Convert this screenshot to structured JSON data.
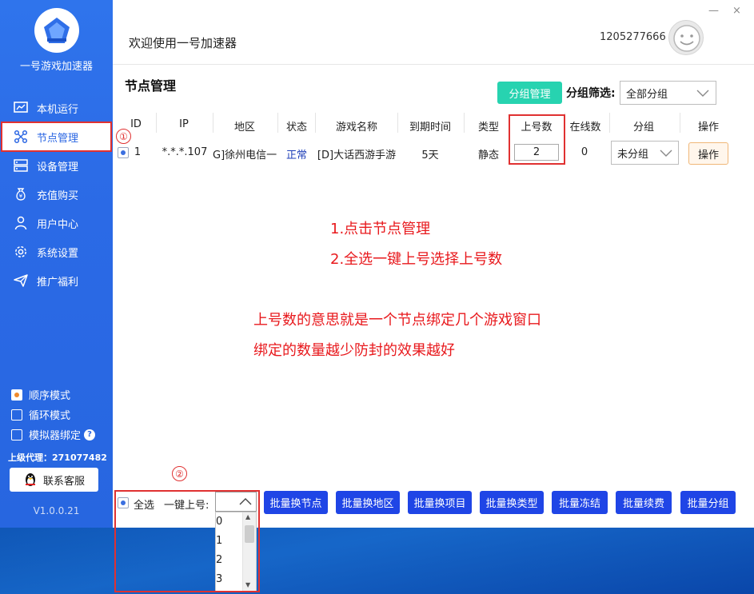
{
  "app": {
    "name": "一号游戏加速器",
    "welcome": "欢迎使用一号加速器",
    "user_id": "1205277666",
    "version": "V1.0.0.21",
    "close_glyph": "×",
    "minimize_glyph": "—"
  },
  "sidebar": {
    "items": [
      {
        "label": "本机运行",
        "icon": "monitor-chart-icon"
      },
      {
        "label": "节点管理",
        "icon": "nodes-icon"
      },
      {
        "label": "设备管理",
        "icon": "server-icon"
      },
      {
        "label": "充值购买",
        "icon": "yen-bag-icon"
      },
      {
        "label": "用户中心",
        "icon": "user-icon"
      },
      {
        "label": "系统设置",
        "icon": "gear-icon"
      },
      {
        "label": "推广福利",
        "icon": "send-icon"
      }
    ],
    "modes": [
      {
        "label": "顺序模式",
        "checked": true
      },
      {
        "label": "循环模式",
        "checked": false
      },
      {
        "label": "模拟器绑定",
        "checked": false
      }
    ],
    "agent": "上级代理：271077482",
    "service_label": "联系客服"
  },
  "page": {
    "title": "节点管理",
    "group_mgmt_label": "分组管理",
    "filter_label": "分组筛选:",
    "filter_value": "全部分组"
  },
  "table": {
    "headers": [
      "ID",
      "IP",
      "地区",
      "状态",
      "游戏名称",
      "到期时间",
      "类型",
      "上号数",
      "在线数",
      "分组",
      "操作"
    ],
    "rows": [
      {
        "id": "1",
        "ip": "*.*.*.107",
        "region": "G]徐州电信一纟",
        "status": "正常",
        "game": "[D]大话西游手游",
        "expiry": "5天",
        "type": "静态",
        "qty": "2",
        "online": "0",
        "group": "未分组",
        "op": "操作"
      }
    ]
  },
  "annotations": {
    "marker1": "①",
    "marker2": "②",
    "step1": "1.点击节点管理",
    "step2": "2.全选一键上号选择上号数",
    "explain1": "上号数的意思就是一个节点绑定几个游戏窗口",
    "explain2": "绑定的数量越少防封的效果越好"
  },
  "bottom": {
    "select_all": "全选",
    "one_key_label": "一键上号:",
    "options": [
      "0",
      "1",
      "2",
      "3"
    ],
    "batch_buttons": [
      "批量换节点",
      "批量换地区",
      "批量换项目",
      "批量换类型",
      "批量冻结",
      "批量续费",
      "批量分组"
    ]
  },
  "colors": {
    "sidebar": "#2b6ae6",
    "accent_teal": "#27d3b0",
    "batch_blue": "#1f45e6",
    "annotation_red": "#e8191d",
    "status_blue": "#1f3fb8"
  }
}
